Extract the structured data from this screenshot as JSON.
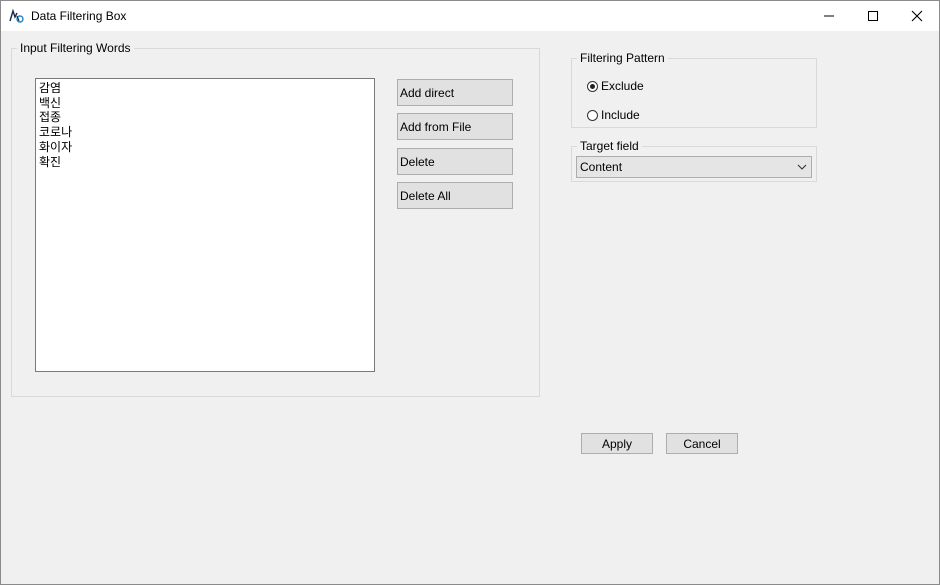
{
  "window": {
    "title": "Data Filtering Box",
    "icon": "app-logo-icon",
    "controls": [
      "minimize-icon",
      "maximize-icon",
      "close-icon"
    ]
  },
  "filter_words": {
    "legend": "Input Filtering Words",
    "items": [
      "감염",
      "백신",
      "접종",
      "코로나",
      "화이자",
      "확진"
    ],
    "buttons": {
      "add_direct": "Add direct",
      "add_from_file": "Add from File",
      "delete": "Delete",
      "delete_all": "Delete All"
    }
  },
  "filtering_pattern": {
    "legend": "Filtering Pattern",
    "options": [
      {
        "label": "Exclude",
        "checked": true
      },
      {
        "label": "Include",
        "checked": false
      }
    ]
  },
  "target_field": {
    "legend": "Target field",
    "selected": "Content"
  },
  "actions": {
    "apply": "Apply",
    "cancel": "Cancel"
  }
}
